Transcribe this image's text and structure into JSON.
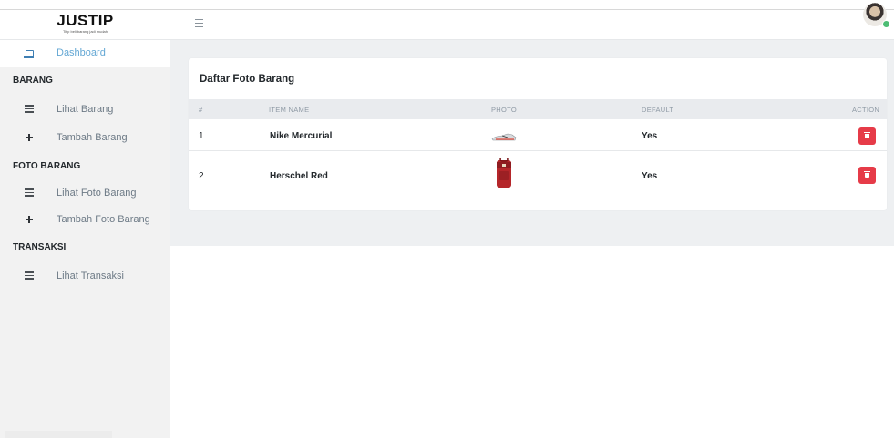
{
  "header": {
    "brand_title": "JUSTIP",
    "brand_tagline": "Titip beli barang jadi mudah"
  },
  "sidebar": {
    "dashboard": "Dashboard",
    "section_barang": "BARANG",
    "lihat_barang": "Lihat Barang",
    "tambah_barang": "Tambah Barang",
    "section_foto": "FOTO BARANG",
    "lihat_foto": "Lihat Foto Barang",
    "tambah_foto": "Tambah Foto Barang",
    "section_transaksi": "TRANSAKSI",
    "lihat_transaksi": "Lihat Transaksi"
  },
  "card": {
    "title": "Daftar Foto Barang",
    "columns": [
      "#",
      "ITEM NAME",
      "PHOTO",
      "DEFAULT",
      "ACTION"
    ],
    "rows": [
      {
        "no": "1",
        "name": "Nike Mercurial",
        "photo": "shoe-photo",
        "default": "Yes"
      },
      {
        "no": "2",
        "name": "Herschel Red",
        "photo": "backpack-photo",
        "default": "Yes"
      }
    ]
  },
  "colors": {
    "accent": "#63a7d4",
    "danger": "#e63b48",
    "status_online": "#4dbd74"
  },
  "icons": [
    "hamburger-icon",
    "laptop-icon",
    "list-icon",
    "plus-icon",
    "trash-icon"
  ]
}
